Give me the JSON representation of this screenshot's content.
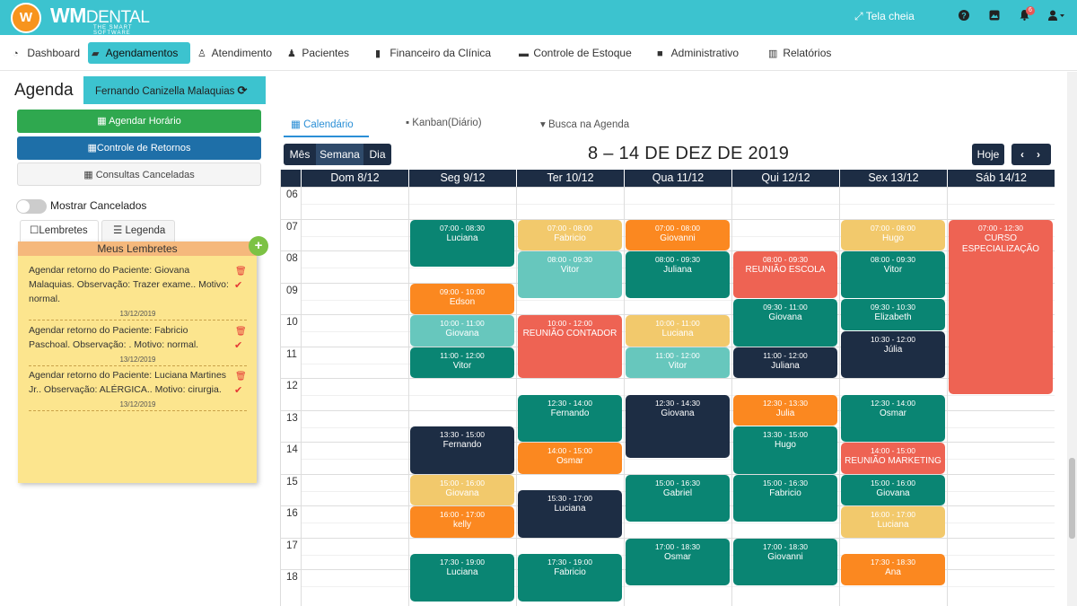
{
  "brand": {
    "logo_letters": "W",
    "name_main": "WM",
    "name_dental": "DENTAL",
    "tagline": "THE SMART SOFTWARE"
  },
  "topbar": {
    "fullscreen_label": "Tela cheia",
    "notification_count": "6"
  },
  "nav": [
    {
      "label": "Dashboard",
      "icon": "dashboard-icon",
      "glyph": "◔"
    },
    {
      "label": "Agendamentos",
      "icon": "book-icon",
      "glyph": "▰"
    },
    {
      "label": "Atendimento",
      "icon": "user-md-icon",
      "glyph": "♙"
    },
    {
      "label": "Pacientes",
      "icon": "users-icon",
      "glyph": "♟"
    },
    {
      "label": "Financeiro da Clínica",
      "icon": "bookmark-icon",
      "glyph": "▮"
    },
    {
      "label": "Controle de Estoque",
      "icon": "box-icon",
      "glyph": "▬"
    },
    {
      "label": "Administrativo",
      "icon": "lock-icon",
      "glyph": "■"
    },
    {
      "label": "Relatórios",
      "icon": "bar-chart-icon",
      "glyph": "▥"
    }
  ],
  "page": {
    "title": "Agenda",
    "doctor": "Fernando Canizella Malaquias"
  },
  "sidebar": {
    "btn_schedule": "Agendar Horário",
    "btn_returns": "Controle de Retornos",
    "btn_cancelled": "Consultas Canceladas",
    "toggle_label": "Mostrar Cancelados",
    "tab_reminders": "Lembretes",
    "tab_legend": "Legenda",
    "reminders_title": "Meus Lembretes",
    "reminders": [
      {
        "text": "Agendar retorno do Paciente: Giovana Malaquias. Observação: Trazer exame.. Motivo: normal.",
        "date": "13/12/2019"
      },
      {
        "text": "Agendar retorno do Paciente: Fabricio Paschoal. Observação: . Motivo: normal.",
        "date": "13/12/2019"
      },
      {
        "text": "Agendar retorno do Paciente: Luciana Martines Jr.. Observação: ALÉRGICA.. Motivo: cirurgia.",
        "date": "13/12/2019"
      }
    ]
  },
  "calendar": {
    "tabs": [
      "Calendário",
      "Kanban(Diário)",
      "Busca na Agenda"
    ],
    "views": [
      "Mês",
      "Semana",
      "Dia"
    ],
    "active_view": "Semana",
    "week_title": "8 – 14 DE DEZ DE 2019",
    "today_label": "Hoje",
    "days": [
      "Dom 8/12",
      "Seg 9/12",
      "Ter 10/12",
      "Qua 11/12",
      "Qui 12/12",
      "Sex 13/12",
      "Sáb 14/12"
    ],
    "hours": [
      "06",
      "07",
      "08",
      "09",
      "10",
      "11",
      "12",
      "13",
      "14",
      "15",
      "16",
      "17",
      "18"
    ],
    "colors": {
      "green": "#0a8573",
      "teal": "#67c7bd",
      "orange": "#fb8820",
      "yellow": "#f2c96c",
      "red": "#ee6353",
      "navy": "#1d2d44"
    },
    "events": [
      {
        "day": 1,
        "time": "07:00 - 08:30",
        "name": "Luciana",
        "color": "green"
      },
      {
        "day": 1,
        "time": "09:00 - 10:00",
        "name": "Edson",
        "color": "orange"
      },
      {
        "day": 1,
        "time": "10:00 - 11:00",
        "name": "Giovana",
        "color": "teal"
      },
      {
        "day": 1,
        "time": "11:00 - 12:00",
        "name": "Vitor",
        "color": "green"
      },
      {
        "day": 1,
        "time": "13:30 - 15:00",
        "name": "Fernando",
        "color": "navy"
      },
      {
        "day": 1,
        "time": "15:00 - 16:00",
        "name": "Giovana",
        "color": "yellow"
      },
      {
        "day": 1,
        "time": "16:00 - 17:00",
        "name": "kelly",
        "color": "orange"
      },
      {
        "day": 1,
        "time": "17:30 - 19:00",
        "name": "Luciana",
        "color": "green"
      },
      {
        "day": 2,
        "time": "07:00 - 08:00",
        "name": "Fabricio",
        "color": "yellow"
      },
      {
        "day": 2,
        "time": "08:00 - 09:30",
        "name": "Vitor",
        "color": "teal"
      },
      {
        "day": 2,
        "time": "10:00 - 12:00",
        "name": "REUNIÃO CONTADOR",
        "color": "red"
      },
      {
        "day": 2,
        "time": "12:30 - 14:00",
        "name": "Fernando",
        "color": "green"
      },
      {
        "day": 2,
        "time": "14:00 - 15:00",
        "name": "Osmar",
        "color": "orange"
      },
      {
        "day": 2,
        "time": "15:30 - 17:00",
        "name": "Luciana",
        "color": "navy"
      },
      {
        "day": 2,
        "time": "17:30 - 19:00",
        "name": "Fabricio",
        "color": "green"
      },
      {
        "day": 3,
        "time": "07:00 - 08:00",
        "name": "Giovanni",
        "color": "orange"
      },
      {
        "day": 3,
        "time": "08:00 - 09:30",
        "name": "Juliana",
        "color": "green"
      },
      {
        "day": 3,
        "time": "10:00 - 11:00",
        "name": "Luciana",
        "color": "yellow"
      },
      {
        "day": 3,
        "time": "11:00 - 12:00",
        "name": "Vitor",
        "color": "teal"
      },
      {
        "day": 3,
        "time": "12:30 - 14:30",
        "name": "Giovana",
        "color": "navy"
      },
      {
        "day": 3,
        "time": "15:00 - 16:30",
        "name": "Gabriel",
        "color": "green"
      },
      {
        "day": 3,
        "time": "17:00 - 18:30",
        "name": "Osmar",
        "color": "green"
      },
      {
        "day": 4,
        "time": "08:00 - 09:30",
        "name": "REUNIÃO ESCOLA",
        "color": "red"
      },
      {
        "day": 4,
        "time": "09:30 - 11:00",
        "name": "Giovana",
        "color": "green"
      },
      {
        "day": 4,
        "time": "11:00 - 12:00",
        "name": "Juliana",
        "color": "navy"
      },
      {
        "day": 4,
        "time": "12:30 - 13:30",
        "name": "Julia",
        "color": "orange"
      },
      {
        "day": 4,
        "time": "13:30 - 15:00",
        "name": "Hugo",
        "color": "green"
      },
      {
        "day": 4,
        "time": "15:00 - 16:30",
        "name": "Fabricio",
        "color": "green"
      },
      {
        "day": 4,
        "time": "17:00 - 18:30",
        "name": "Giovanni",
        "color": "green"
      },
      {
        "day": 5,
        "time": "07:00 - 08:00",
        "name": "Hugo",
        "color": "yellow"
      },
      {
        "day": 5,
        "time": "08:00 - 09:30",
        "name": "Vitor",
        "color": "green"
      },
      {
        "day": 5,
        "time": "09:30 - 10:30",
        "name": "Elizabeth",
        "color": "green"
      },
      {
        "day": 5,
        "time": "10:30 - 12:00",
        "name": "Júlia",
        "color": "navy"
      },
      {
        "day": 5,
        "time": "12:30 - 14:00",
        "name": "Osmar",
        "color": "green"
      },
      {
        "day": 5,
        "time": "14:00 - 15:00",
        "name": "REUNIÃO MARKETING",
        "color": "red"
      },
      {
        "day": 5,
        "time": "15:00 - 16:00",
        "name": "Giovana",
        "color": "green"
      },
      {
        "day": 5,
        "time": "16:00 - 17:00",
        "name": "Luciana",
        "color": "yellow"
      },
      {
        "day": 5,
        "time": "17:30 - 18:30",
        "name": "Ana",
        "color": "orange"
      },
      {
        "day": 6,
        "time": "07:00 - 12:30",
        "name": "CURSO ESPECIALIZAÇÃO",
        "color": "red"
      }
    ]
  }
}
